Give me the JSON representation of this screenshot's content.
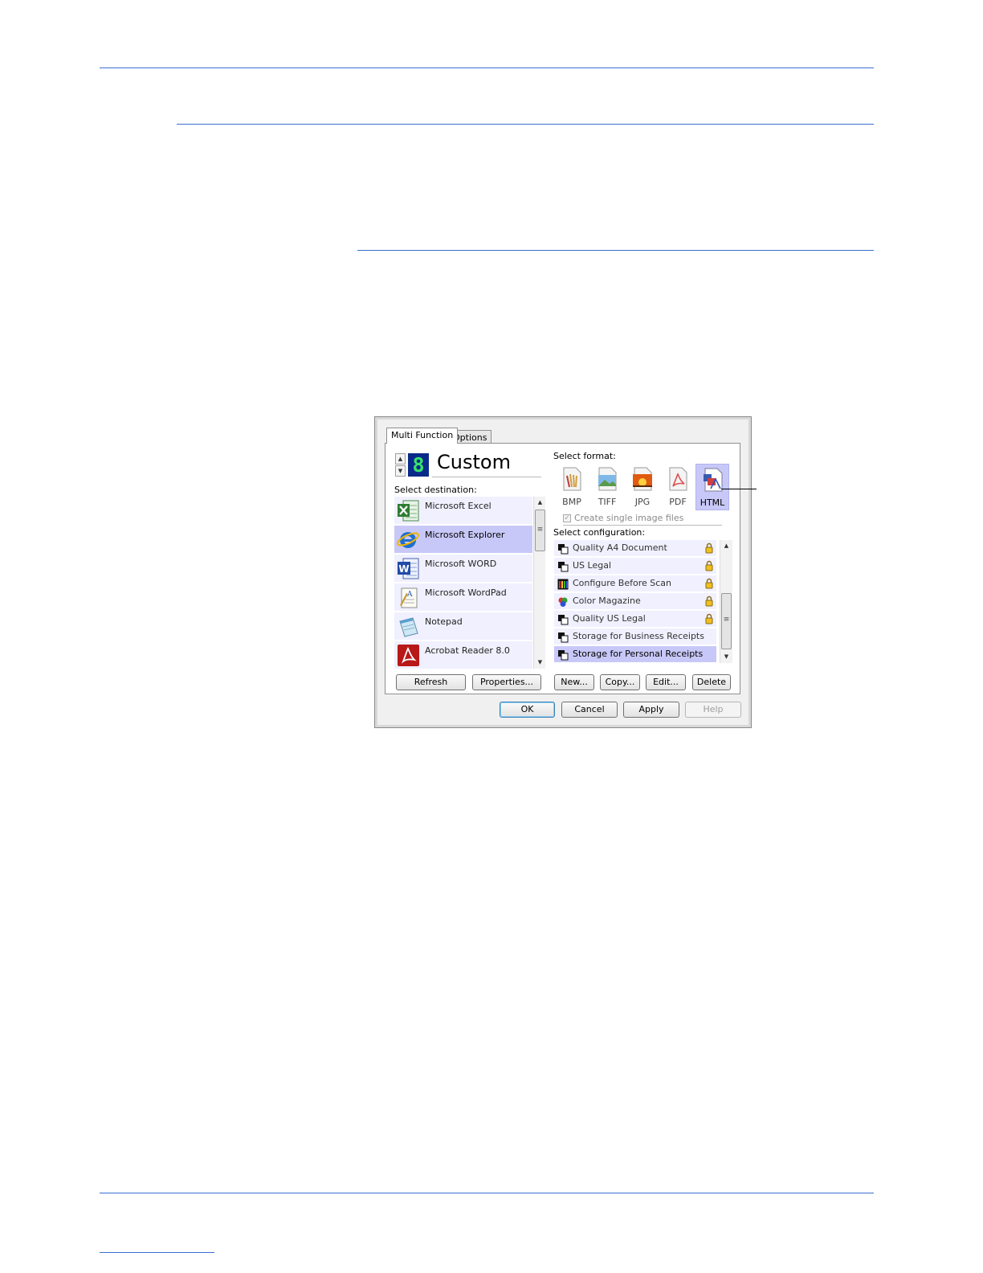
{
  "dialog": {
    "tabs": [
      {
        "label": "Multi Function"
      },
      {
        "label": "Options"
      }
    ],
    "profile": {
      "digit": "8",
      "name": "Custom"
    },
    "destination": {
      "label": "Select destination:",
      "items": [
        {
          "label": "Microsoft Excel",
          "icon": "excel-icon"
        },
        {
          "label": "Microsoft Explorer",
          "icon": "internet-explorer-icon",
          "selected": true
        },
        {
          "label": "Microsoft WORD",
          "icon": "word-icon"
        },
        {
          "label": "Microsoft WordPad",
          "icon": "wordpad-icon"
        },
        {
          "label": "Notepad",
          "icon": "notepad-icon"
        },
        {
          "label": "Acrobat Reader 8.0",
          "icon": "acrobat-icon"
        }
      ],
      "refresh_label": "Refresh",
      "properties_label": "Properties..."
    },
    "format": {
      "label": "Select format:",
      "options": [
        {
          "label": "BMP"
        },
        {
          "label": "TIFF"
        },
        {
          "label": "JPG"
        },
        {
          "label": "PDF"
        },
        {
          "label": "HTML",
          "selected": true
        }
      ],
      "single_image_label": "Create single image files",
      "single_image_checked": true
    },
    "configuration": {
      "label": "Select configuration:",
      "items": [
        {
          "label": "Quality A4 Document",
          "locked": true
        },
        {
          "label": "US Legal",
          "locked": true
        },
        {
          "label": "Configure Before Scan",
          "locked": true
        },
        {
          "label": "Color Magazine",
          "locked": true
        },
        {
          "label": "Quality US Legal",
          "locked": true
        },
        {
          "label": "Storage for Business Receipts",
          "locked": false
        },
        {
          "label": "Storage for Personal Receipts",
          "locked": false,
          "selected": true
        }
      ],
      "new_label": "New...",
      "copy_label": "Copy...",
      "edit_label": "Edit...",
      "delete_label": "Delete"
    },
    "footer": {
      "ok_label": "OK",
      "cancel_label": "Cancel",
      "apply_label": "Apply",
      "help_label": "Help"
    }
  },
  "colors": {
    "rule": "#3a6fd0",
    "selection": "#c8c8f8",
    "list_bg": "#f0f0ff"
  }
}
